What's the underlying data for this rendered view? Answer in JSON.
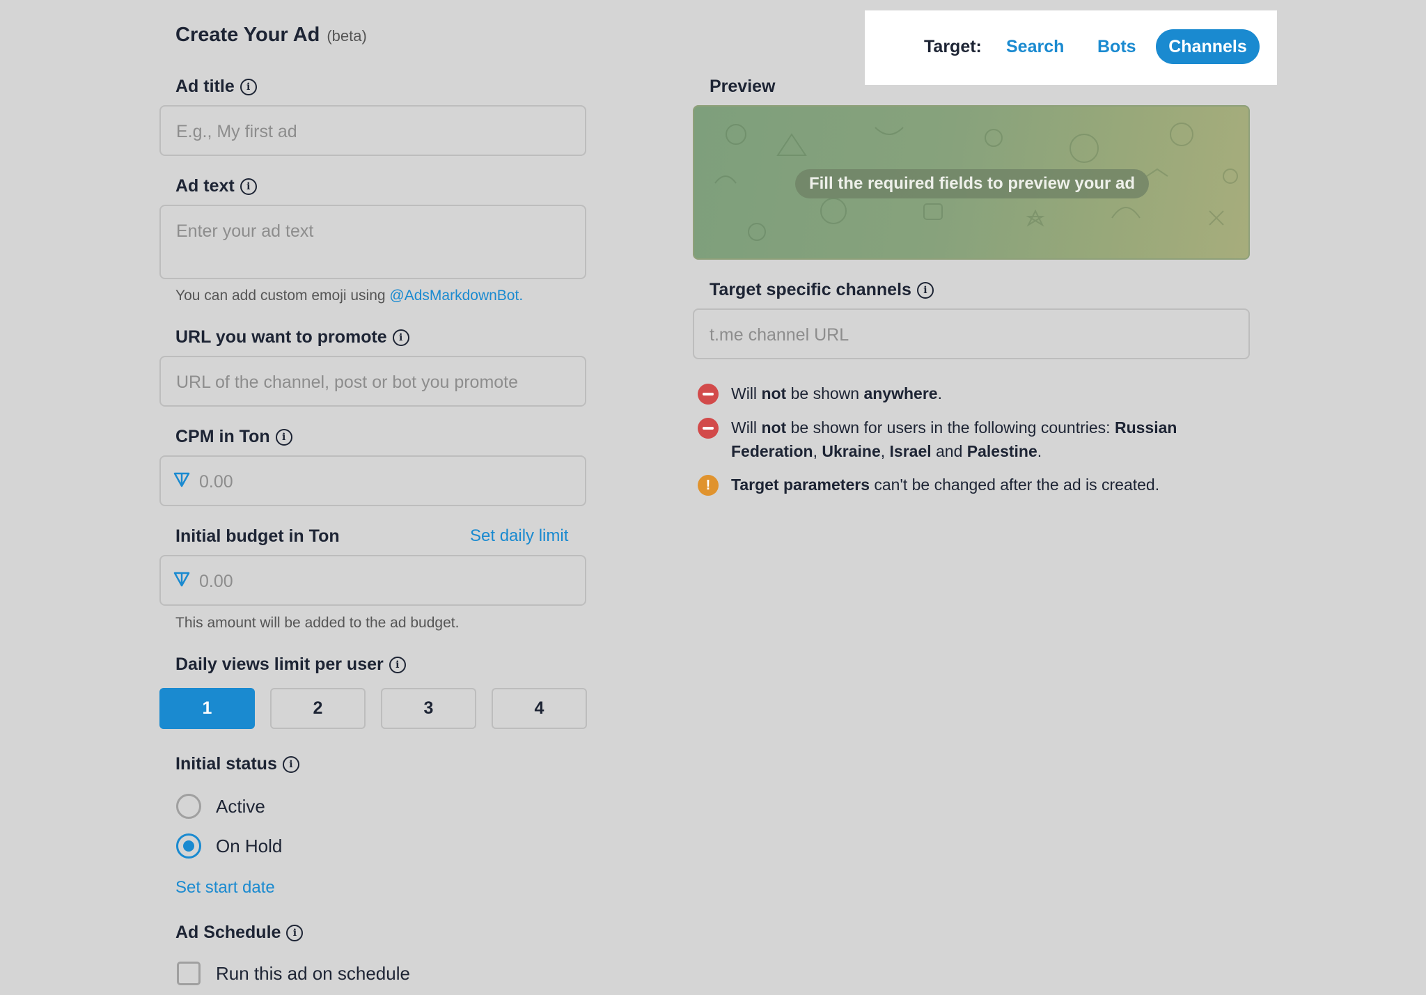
{
  "form": {
    "title": "Create Your Ad",
    "beta": "(beta)",
    "ad_title": {
      "label": "Ad title",
      "placeholder": "E.g., My first ad"
    },
    "ad_text": {
      "label": "Ad text",
      "placeholder": "Enter your ad text",
      "hint_prefix": "You can add custom emoji using ",
      "hint_link": "@AdsMarkdownBot",
      "hint_suffix": "."
    },
    "url": {
      "label": "URL you want to promote",
      "placeholder": "URL of the channel, post or bot you promote"
    },
    "cpm": {
      "label": "CPM in Ton",
      "placeholder": "0.00"
    },
    "budget": {
      "label": "Initial budget in Ton",
      "daily_limit_link": "Set daily limit",
      "placeholder": "0.00",
      "hint": "This amount will be added to the ad budget."
    },
    "views": {
      "label": "Daily views limit per user",
      "options": [
        "1",
        "2",
        "3",
        "4"
      ],
      "selected": "1"
    },
    "status": {
      "label": "Initial status",
      "options": [
        "Active",
        "On Hold"
      ],
      "selected": "On Hold",
      "start_date_link": "Set start date"
    },
    "schedule": {
      "label": "Ad Schedule",
      "checkbox_label": "Run this ad on schedule",
      "checked": false
    }
  },
  "target": {
    "label": "Target:",
    "options": [
      "Search",
      "Bots",
      "Channels"
    ],
    "selected": "Channels"
  },
  "preview": {
    "label": "Preview",
    "message": "Fill the required fields to preview your ad"
  },
  "channels": {
    "label": "Target specific channels",
    "placeholder": "t.me channel URL"
  },
  "notes": {
    "n1": {
      "p1": "Will ",
      "b1": "not",
      "p2": " be shown ",
      "b2": "anywhere",
      "p3": "."
    },
    "n2": {
      "p1": "Will ",
      "b1": "not",
      "p2": " be shown for users in the following countries: ",
      "b2": "Russian Federation",
      "p3": ", ",
      "b3": "Ukraine",
      "p4": ", ",
      "b4": "Israel",
      "p5": " and ",
      "b5": "Palestine",
      "p6": "."
    },
    "n3": {
      "b1": "Target parameters",
      "p1": " can't be changed after the ad is created."
    }
  },
  "colors": {
    "accent": "#1a8ad0",
    "background": "#d5d5d5",
    "error": "#d24a4a",
    "warning": "#e0932e"
  }
}
